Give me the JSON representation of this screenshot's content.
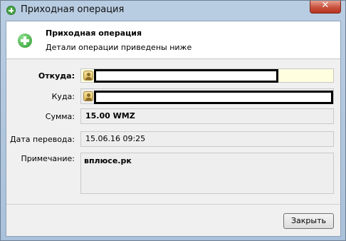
{
  "window": {
    "title": "Приходная операция",
    "close_glyph": "✕"
  },
  "header": {
    "title": "Приходная операция",
    "subtitle": "Детали операции приведены ниже",
    "icon": "plus-circle-icon"
  },
  "form": {
    "from_label": "Откуда:",
    "to_label": "Куда:",
    "amount_label": "Сумма:",
    "amount_value": "15.00 WMZ",
    "date_label": "Дата перевода:",
    "date_value": "15.06.16 09:25",
    "note_label": "Примечание:",
    "note_value": "вплюсе.рк"
  },
  "buttons": {
    "close_label": "Закрыть"
  },
  "colors": {
    "accent": "#2f9b2f",
    "from_field_bg": "#ffffe0"
  }
}
